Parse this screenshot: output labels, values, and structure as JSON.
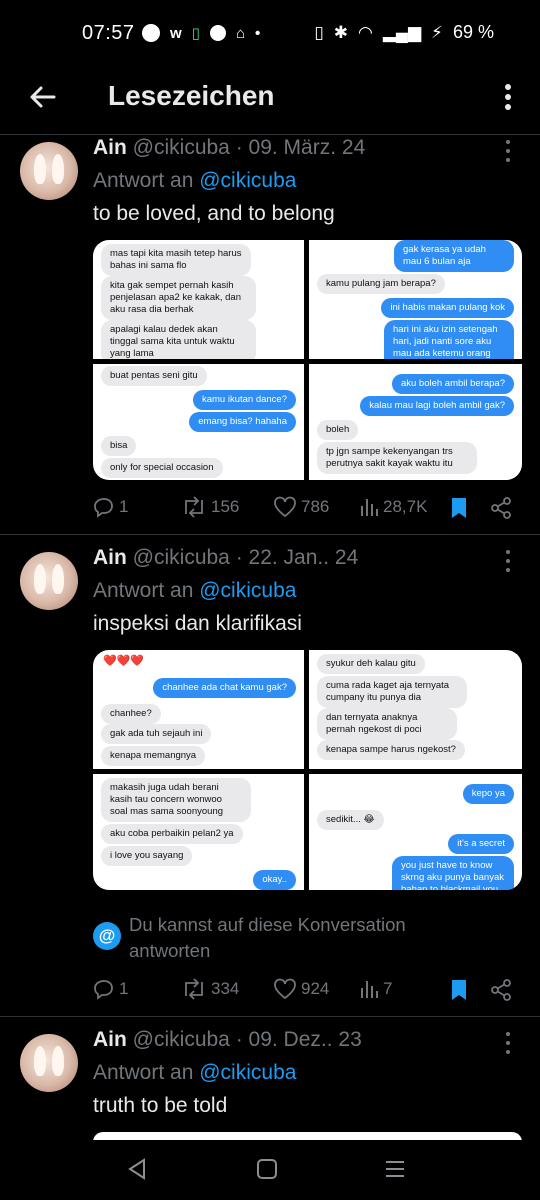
{
  "status": {
    "time": "07:57",
    "battery": "69 %"
  },
  "header": {
    "title": "Lesezeichen"
  },
  "tweets": [
    {
      "name": "Ain",
      "handle": "@cikicuba",
      "date": "· 09. März. 24",
      "reply_prefix": "Antwort an",
      "reply_mention": "@cikicuba",
      "text": "to be loved, and to belong",
      "chat": {
        "p1": [
          "mas tapi kita masih tetep harus bahas ini sama flo",
          "kita gak sempet pernah kasih penjelasan apa2 ke kakak, dan aku rasa dia berhak",
          "apalagi kalau dedek akan tinggal sama kita untuk waktu yang lama"
        ],
        "p2": [
          "gak kerasa ya udah mau 6 bulan aja",
          "kamu pulang jam berapa?",
          "ini habis makan pulang kok",
          "hari ini aku izin setengah hari, jadi nanti sore aku mau ada ketemu orang dulu ya"
        ],
        "p3": [
          "buat pentas seni gitu",
          "kamu ikutan dance?",
          "emang bisa? hahaha",
          "bisa",
          "only for special occasion"
        ],
        "p4": [
          "aku boleh ambil berapa?",
          "kalau mau lagi boleh ambil gak?",
          "boleh",
          "tp jgn sampe kekenyangan trs perutnya sakit kayak waktu itu"
        ]
      },
      "replies": "1",
      "retweets": "156",
      "likes": "786",
      "views": "28,7K"
    },
    {
      "name": "Ain",
      "handle": "@cikicuba",
      "date": "· 22. Jan.. 24",
      "reply_prefix": "Antwort an",
      "reply_mention": "@cikicuba",
      "text": "inspeksi dan klarifikasi",
      "chat": {
        "p1": [
          "❤️❤️❤️",
          "chanhee ada chat kamu gak?",
          "chanhee?",
          "gak ada tuh sejauh ini",
          "kenapa memangnya"
        ],
        "p2": [
          "syukur deh kalau gitu",
          "cuma rada kaget aja ternyata cumpany itu punya dia",
          "dan ternyata anaknya pernah ngekost di poci",
          "kenapa sampe harus ngekost?"
        ],
        "p3": [
          "makasih juga udah berani kasih tau concern wonwoo soal mas sama soonyoung",
          "aku coba perbaikin pelan2 ya",
          "i love you sayang",
          "okay.."
        ],
        "p4": [
          "kepo ya",
          "sedikit... 😂",
          "it's a secret",
          "you just have to know skrng aku punya banyak bahan to blackmail you"
        ]
      },
      "convo_note": "Du kannst auf diese Konversation antworten",
      "replies": "1",
      "retweets": "334",
      "likes": "924",
      "views": "7"
    },
    {
      "name": "Ain",
      "handle": "@cikicuba",
      "date": "· 09. Dez.. 23",
      "reply_prefix": "Antwort an",
      "reply_mention": "@cikicuba",
      "text": "truth to be told"
    }
  ],
  "colors": {
    "accent": "#1d9bf0",
    "muted": "#71767b",
    "text": "#e7e9ea",
    "bubble_out": "#2f8df4",
    "bubble_in": "#e9e9eb"
  }
}
